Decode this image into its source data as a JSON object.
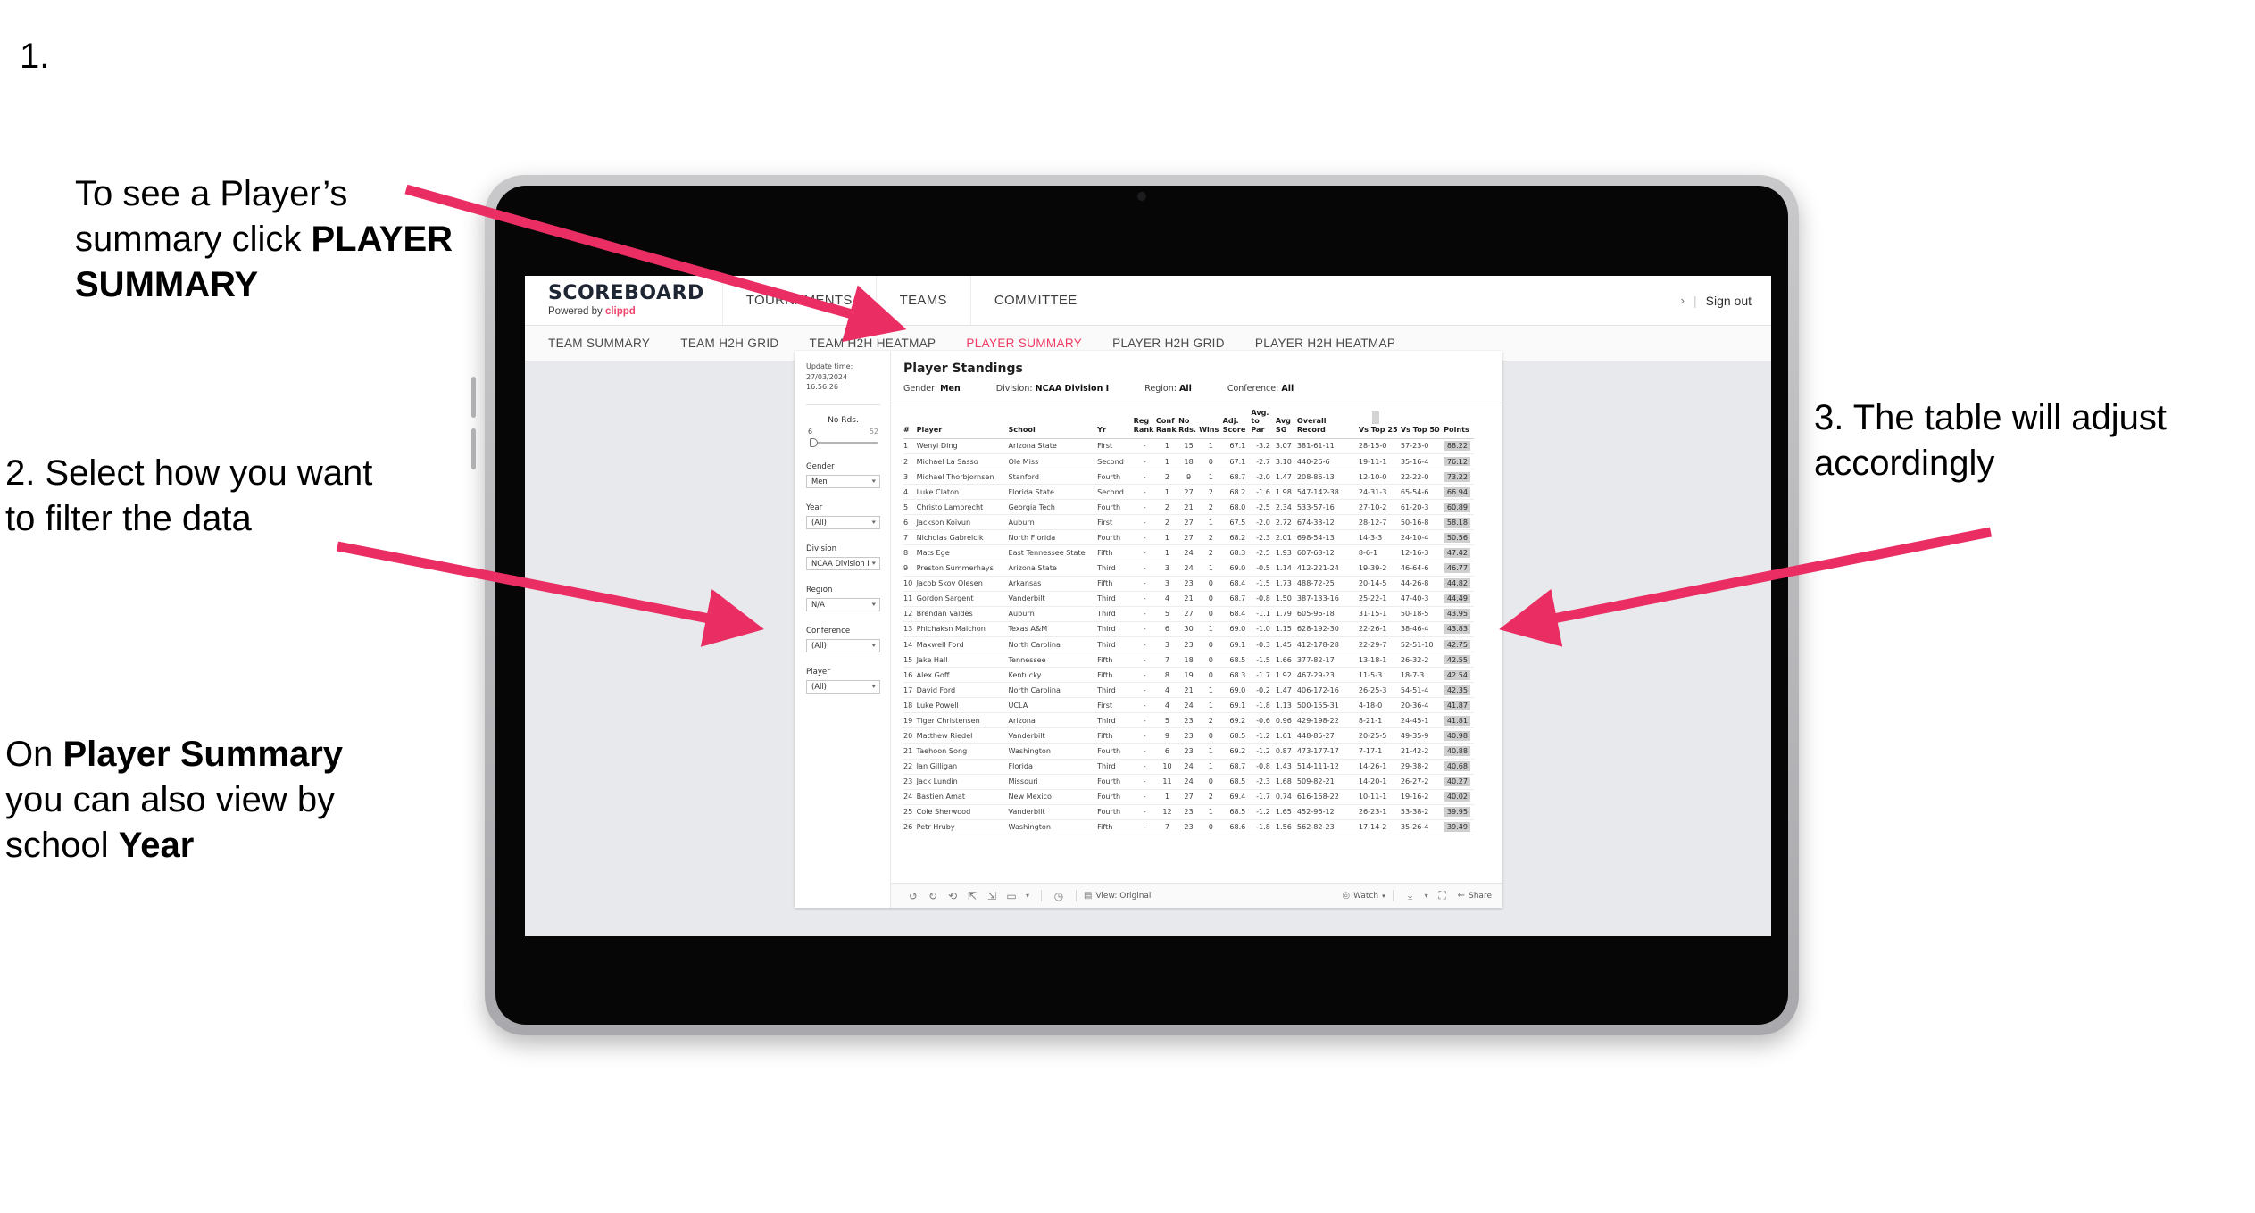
{
  "callouts": {
    "one_number": "1.",
    "one_pre": "To see a Player’s\nsummary click ",
    "one_bold": "PLAYER SUMMARY",
    "two": "2. Select how you want to filter the data",
    "three_pre": "On ",
    "three_b1": "Player Summary",
    "three_mid": " you can also view by school ",
    "three_b2": "Year",
    "four": "3. The table will adjust accordingly"
  },
  "colors": {
    "accent_pink": "#ef3a64",
    "arrow_pink": "#ea2e63",
    "brand_dark": "#1f2633",
    "page_bg": "#e8e9ec"
  },
  "app": {
    "brand_title": "SCOREBOARD",
    "brand_sub_prefix": "Powered by ",
    "brand_sub_link": "clippd",
    "top_nav": [
      "TOURNAMENTS",
      "TEAMS",
      "COMMITTEE"
    ],
    "top_right": {
      "glyph": "›",
      "divider": "|",
      "sign_out": "Sign out"
    },
    "sub_nav": [
      {
        "label": "TEAM SUMMARY",
        "active": false
      },
      {
        "label": "TEAM H2H GRID",
        "active": false
      },
      {
        "label": "TEAM H2H HEATMAP",
        "active": false
      },
      {
        "label": "PLAYER SUMMARY",
        "active": true
      },
      {
        "label": "PLAYER H2H GRID",
        "active": false
      },
      {
        "label": "PLAYER H2H HEATMAP",
        "active": false
      }
    ]
  },
  "viz": {
    "update_label": "Update time:",
    "update_value": "27/03/2024 16:56:26",
    "title": "Player Standings",
    "params": [
      {
        "label": "Gender:",
        "value": "Men"
      },
      {
        "label": "Division:",
        "value": "NCAA Division I"
      },
      {
        "label": "Region:",
        "value": "All"
      },
      {
        "label": "Conference:",
        "value": "All"
      }
    ],
    "filters": {
      "slider": {
        "title": "No Rds.",
        "min": "6",
        "max": "52"
      },
      "selects": [
        {
          "title": "Gender",
          "value": "Men"
        },
        {
          "title": "Year",
          "value": "(All)"
        },
        {
          "title": "Division",
          "value": "NCAA Division I"
        },
        {
          "title": "Region",
          "value": "N/A"
        },
        {
          "title": "Conference",
          "value": "(All)"
        },
        {
          "title": "Player",
          "value": "(All)"
        }
      ]
    },
    "toolbar": {
      "icons": [
        "undo-icon",
        "redo-icon",
        "revert-icon",
        "pause-refresh-icon",
        "refresh-icon",
        "filter-icon",
        "caret-down-icon",
        "clock-icon"
      ],
      "view_label": "View: Original",
      "watch_label": "Watch",
      "share_label": "Share"
    }
  },
  "table": {
    "headers": [
      {
        "l1": "#",
        "l2": ""
      },
      {
        "l1": "Player",
        "l2": ""
      },
      {
        "l1": "School",
        "l2": ""
      },
      {
        "l1": "Yr",
        "l2": ""
      },
      {
        "l1": "Reg",
        "l2": "Rank"
      },
      {
        "l1": "Conf",
        "l2": "Rank"
      },
      {
        "l1": "No",
        "l2": "Rds."
      },
      {
        "l1": "",
        "l2": "Wins"
      },
      {
        "l1": "Adj.",
        "l2": "Score"
      },
      {
        "l1": "Avg.",
        "l2": "to Par"
      },
      {
        "l1": "Avg",
        "l2": "SG"
      },
      {
        "l1": "Overall",
        "l2": "Record"
      },
      {
        "l1": "",
        "l2": "Vs Top 25"
      },
      {
        "l1": "",
        "l2": "Vs Top 50"
      },
      {
        "l1": "",
        "l2": "Points"
      }
    ],
    "rows": [
      {
        "rank": "1",
        "player": "Wenyi Ding",
        "school": "Arizona State",
        "yr": "First",
        "reg": "-",
        "conf": "1",
        "nords": "15",
        "wins": "1",
        "adj": "67.1",
        "par": "-3.2",
        "sg": "3.07",
        "rec": "381-61-11",
        "t25": "28-15-0",
        "t50": "57-23-0",
        "pts": "88.22"
      },
      {
        "rank": "2",
        "player": "Michael La Sasso",
        "school": "Ole Miss",
        "yr": "Second",
        "reg": "-",
        "conf": "1",
        "nords": "18",
        "wins": "0",
        "adj": "67.1",
        "par": "-2.7",
        "sg": "3.10",
        "rec": "440-26-6",
        "t25": "19-11-1",
        "t50": "35-16-4",
        "pts": "76.12"
      },
      {
        "rank": "3",
        "player": "Michael Thorbjornsen",
        "school": "Stanford",
        "yr": "Fourth",
        "reg": "-",
        "conf": "2",
        "nords": "9",
        "wins": "1",
        "adj": "68.7",
        "par": "-2.0",
        "sg": "1.47",
        "rec": "208-86-13",
        "t25": "12-10-0",
        "t50": "22-22-0",
        "pts": "73.22"
      },
      {
        "rank": "4",
        "player": "Luke Claton",
        "school": "Florida State",
        "yr": "Second",
        "reg": "-",
        "conf": "1",
        "nords": "27",
        "wins": "2",
        "adj": "68.2",
        "par": "-1.6",
        "sg": "1.98",
        "rec": "547-142-38",
        "t25": "24-31-3",
        "t50": "65-54-6",
        "pts": "66.94"
      },
      {
        "rank": "5",
        "player": "Christo Lamprecht",
        "school": "Georgia Tech",
        "yr": "Fourth",
        "reg": "-",
        "conf": "2",
        "nords": "21",
        "wins": "2",
        "adj": "68.0",
        "par": "-2.5",
        "sg": "2.34",
        "rec": "533-57-16",
        "t25": "27-10-2",
        "t50": "61-20-3",
        "pts": "60.89"
      },
      {
        "rank": "6",
        "player": "Jackson Koivun",
        "school": "Auburn",
        "yr": "First",
        "reg": "-",
        "conf": "2",
        "nords": "27",
        "wins": "1",
        "adj": "67.5",
        "par": "-2.0",
        "sg": "2.72",
        "rec": "674-33-12",
        "t25": "28-12-7",
        "t50": "50-16-8",
        "pts": "58.18"
      },
      {
        "rank": "7",
        "player": "Nicholas Gabrelcik",
        "school": "North Florida",
        "yr": "Fourth",
        "reg": "-",
        "conf": "1",
        "nords": "27",
        "wins": "2",
        "adj": "68.2",
        "par": "-2.3",
        "sg": "2.01",
        "rec": "698-54-13",
        "t25": "14-3-3",
        "t50": "24-10-4",
        "pts": "50.56"
      },
      {
        "rank": "8",
        "player": "Mats Ege",
        "school": "East Tennessee State",
        "yr": "Fifth",
        "reg": "-",
        "conf": "1",
        "nords": "24",
        "wins": "2",
        "adj": "68.3",
        "par": "-2.5",
        "sg": "1.93",
        "rec": "607-63-12",
        "t25": "8-6-1",
        "t50": "12-16-3",
        "pts": "47.42"
      },
      {
        "rank": "9",
        "player": "Preston Summerhays",
        "school": "Arizona State",
        "yr": "Third",
        "reg": "-",
        "conf": "3",
        "nords": "24",
        "wins": "1",
        "adj": "69.0",
        "par": "-0.5",
        "sg": "1.14",
        "rec": "412-221-24",
        "t25": "19-39-2",
        "t50": "46-64-6",
        "pts": "46.77"
      },
      {
        "rank": "10",
        "player": "Jacob Skov Olesen",
        "school": "Arkansas",
        "yr": "Fifth",
        "reg": "-",
        "conf": "3",
        "nords": "23",
        "wins": "0",
        "adj": "68.4",
        "par": "-1.5",
        "sg": "1.73",
        "rec": "488-72-25",
        "t25": "20-14-5",
        "t50": "44-26-8",
        "pts": "44.82"
      },
      {
        "rank": "11",
        "player": "Gordon Sargent",
        "school": "Vanderbilt",
        "yr": "Third",
        "reg": "-",
        "conf": "4",
        "nords": "21",
        "wins": "0",
        "adj": "68.7",
        "par": "-0.8",
        "sg": "1.50",
        "rec": "387-133-16",
        "t25": "25-22-1",
        "t50": "47-40-3",
        "pts": "44.49"
      },
      {
        "rank": "12",
        "player": "Brendan Valdes",
        "school": "Auburn",
        "yr": "Third",
        "reg": "-",
        "conf": "5",
        "nords": "27",
        "wins": "0",
        "adj": "68.4",
        "par": "-1.1",
        "sg": "1.79",
        "rec": "605-96-18",
        "t25": "31-15-1",
        "t50": "50-18-5",
        "pts": "43.95"
      },
      {
        "rank": "13",
        "player": "Phichaksn Maichon",
        "school": "Texas A&M",
        "yr": "Third",
        "reg": "-",
        "conf": "6",
        "nords": "30",
        "wins": "1",
        "adj": "69.0",
        "par": "-1.0",
        "sg": "1.15",
        "rec": "628-192-30",
        "t25": "22-26-1",
        "t50": "38-46-4",
        "pts": "43.83"
      },
      {
        "rank": "14",
        "player": "Maxwell Ford",
        "school": "North Carolina",
        "yr": "Third",
        "reg": "-",
        "conf": "3",
        "nords": "23",
        "wins": "0",
        "adj": "69.1",
        "par": "-0.3",
        "sg": "1.45",
        "rec": "412-178-28",
        "t25": "22-29-7",
        "t50": "52-51-10",
        "pts": "42.75"
      },
      {
        "rank": "15",
        "player": "Jake Hall",
        "school": "Tennessee",
        "yr": "Fifth",
        "reg": "-",
        "conf": "7",
        "nords": "18",
        "wins": "0",
        "adj": "68.5",
        "par": "-1.5",
        "sg": "1.66",
        "rec": "377-82-17",
        "t25": "13-18-1",
        "t50": "26-32-2",
        "pts": "42.55"
      },
      {
        "rank": "16",
        "player": "Alex Goff",
        "school": "Kentucky",
        "yr": "Fifth",
        "reg": "-",
        "conf": "8",
        "nords": "19",
        "wins": "0",
        "adj": "68.3",
        "par": "-1.7",
        "sg": "1.92",
        "rec": "467-29-23",
        "t25": "11-5-3",
        "t50": "18-7-3",
        "pts": "42.54"
      },
      {
        "rank": "17",
        "player": "David Ford",
        "school": "North Carolina",
        "yr": "Third",
        "reg": "-",
        "conf": "4",
        "nords": "21",
        "wins": "1",
        "adj": "69.0",
        "par": "-0.2",
        "sg": "1.47",
        "rec": "406-172-16",
        "t25": "26-25-3",
        "t50": "54-51-4",
        "pts": "42.35"
      },
      {
        "rank": "18",
        "player": "Luke Powell",
        "school": "UCLA",
        "yr": "First",
        "reg": "-",
        "conf": "4",
        "nords": "24",
        "wins": "1",
        "adj": "69.1",
        "par": "-1.8",
        "sg": "1.13",
        "rec": "500-155-31",
        "t25": "4-18-0",
        "t50": "20-36-4",
        "pts": "41.87"
      },
      {
        "rank": "19",
        "player": "Tiger Christensen",
        "school": "Arizona",
        "yr": "Third",
        "reg": "-",
        "conf": "5",
        "nords": "23",
        "wins": "2",
        "adj": "69.2",
        "par": "-0.6",
        "sg": "0.96",
        "rec": "429-198-22",
        "t25": "8-21-1",
        "t50": "24-45-1",
        "pts": "41.81"
      },
      {
        "rank": "20",
        "player": "Matthew Riedel",
        "school": "Vanderbilt",
        "yr": "Fifth",
        "reg": "-",
        "conf": "9",
        "nords": "23",
        "wins": "0",
        "adj": "68.5",
        "par": "-1.2",
        "sg": "1.61",
        "rec": "448-85-27",
        "t25": "20-25-5",
        "t50": "49-35-9",
        "pts": "40.98"
      },
      {
        "rank": "21",
        "player": "Taehoon Song",
        "school": "Washington",
        "yr": "Fourth",
        "reg": "-",
        "conf": "6",
        "nords": "23",
        "wins": "1",
        "adj": "69.2",
        "par": "-1.2",
        "sg": "0.87",
        "rec": "473-177-17",
        "t25": "7-17-1",
        "t50": "21-42-2",
        "pts": "40.88"
      },
      {
        "rank": "22",
        "player": "Ian Gilligan",
        "school": "Florida",
        "yr": "Third",
        "reg": "-",
        "conf": "10",
        "nords": "24",
        "wins": "1",
        "adj": "68.7",
        "par": "-0.8",
        "sg": "1.43",
        "rec": "514-111-12",
        "t25": "14-26-1",
        "t50": "29-38-2",
        "pts": "40.68"
      },
      {
        "rank": "23",
        "player": "Jack Lundin",
        "school": "Missouri",
        "yr": "Fourth",
        "reg": "-",
        "conf": "11",
        "nords": "24",
        "wins": "0",
        "adj": "68.5",
        "par": "-2.3",
        "sg": "1.68",
        "rec": "509-82-21",
        "t25": "14-20-1",
        "t50": "26-27-2",
        "pts": "40.27"
      },
      {
        "rank": "24",
        "player": "Bastien Amat",
        "school": "New Mexico",
        "yr": "Fourth",
        "reg": "-",
        "conf": "1",
        "nords": "27",
        "wins": "2",
        "adj": "69.4",
        "par": "-1.7",
        "sg": "0.74",
        "rec": "616-168-22",
        "t25": "10-11-1",
        "t50": "19-16-2",
        "pts": "40.02"
      },
      {
        "rank": "25",
        "player": "Cole Sherwood",
        "school": "Vanderbilt",
        "yr": "Fourth",
        "reg": "-",
        "conf": "12",
        "nords": "23",
        "wins": "1",
        "adj": "68.5",
        "par": "-1.2",
        "sg": "1.65",
        "rec": "452-96-12",
        "t25": "26-23-1",
        "t50": "53-38-2",
        "pts": "39.95"
      },
      {
        "rank": "26",
        "player": "Petr Hruby",
        "school": "Washington",
        "yr": "Fifth",
        "reg": "-",
        "conf": "7",
        "nords": "23",
        "wins": "0",
        "adj": "68.6",
        "par": "-1.8",
        "sg": "1.56",
        "rec": "562-82-23",
        "t25": "17-14-2",
        "t50": "35-26-4",
        "pts": "39.49"
      }
    ]
  }
}
